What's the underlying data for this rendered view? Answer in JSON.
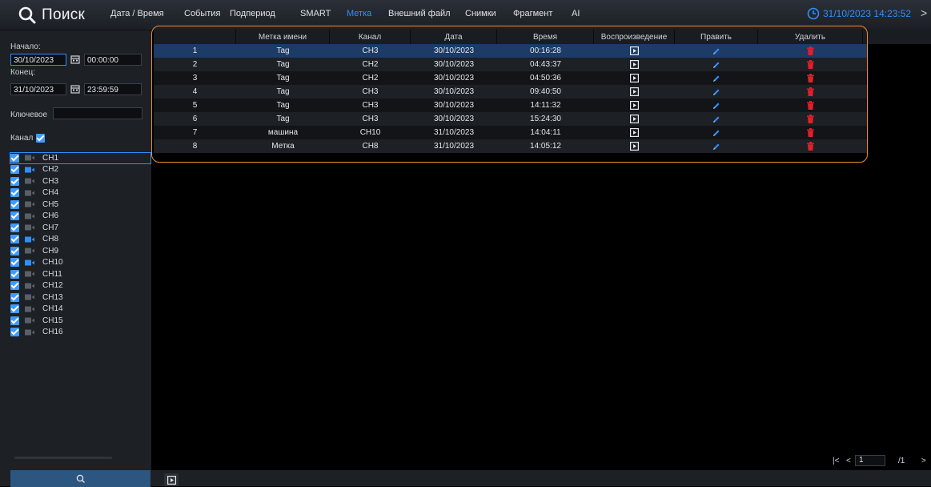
{
  "header": {
    "title": "Поиск",
    "tabs": [
      {
        "label": "Дата / Время",
        "active": false
      },
      {
        "label": "События",
        "active": false
      },
      {
        "label": "Подпериод",
        "active": false
      },
      {
        "label": "SMART",
        "active": false
      },
      {
        "label": "Метка",
        "active": true
      },
      {
        "label": "Внешний файл",
        "active": false
      },
      {
        "label": "Снимки",
        "active": false
      },
      {
        "label": "Фрагмент",
        "active": false
      },
      {
        "label": "AI",
        "active": false
      }
    ],
    "datetime": "31/10/2023 14:23:52",
    "close_glyph": ">"
  },
  "sidebar": {
    "start_label": "Начало:",
    "start_date": "30/10/2023",
    "start_time": "00:00:00",
    "end_label": "Конец:",
    "end_date": "31/10/2023",
    "end_time": "23:59:59",
    "keyword_label": "Ключевое",
    "keyword_value": "",
    "channel_label": "Канал",
    "channels": [
      {
        "name": "CH1",
        "checked": true,
        "active": false
      },
      {
        "name": "CH2",
        "checked": true,
        "active": true
      },
      {
        "name": "CH3",
        "checked": true,
        "active": false
      },
      {
        "name": "CH4",
        "checked": true,
        "active": false
      },
      {
        "name": "CH5",
        "checked": true,
        "active": false
      },
      {
        "name": "CH6",
        "checked": true,
        "active": false
      },
      {
        "name": "CH7",
        "checked": true,
        "active": false
      },
      {
        "name": "CH8",
        "checked": true,
        "active": true
      },
      {
        "name": "CH9",
        "checked": true,
        "active": false
      },
      {
        "name": "CH10",
        "checked": true,
        "active": true
      },
      {
        "name": "CH11",
        "checked": true,
        "active": false
      },
      {
        "name": "CH12",
        "checked": true,
        "active": false
      },
      {
        "name": "CH13",
        "checked": true,
        "active": false
      },
      {
        "name": "CH14",
        "checked": true,
        "active": false
      },
      {
        "name": "CH15",
        "checked": true,
        "active": false
      },
      {
        "name": "CH16",
        "checked": true,
        "active": false
      }
    ]
  },
  "table": {
    "columns": [
      "",
      "Метка имени",
      "Канал",
      "Дата",
      "Время",
      "Воспроизведение",
      "Править",
      "Удалить"
    ],
    "rows": [
      {
        "no": "1",
        "name": "Tag",
        "channel": "CH3",
        "date": "30/10/2023",
        "time": "00:16:28"
      },
      {
        "no": "2",
        "name": "Tag",
        "channel": "CH2",
        "date": "30/10/2023",
        "time": "04:43:37"
      },
      {
        "no": "3",
        "name": "Tag",
        "channel": "CH2",
        "date": "30/10/2023",
        "time": "04:50:36"
      },
      {
        "no": "4",
        "name": "Tag",
        "channel": "CH3",
        "date": "30/10/2023",
        "time": "09:40:50"
      },
      {
        "no": "5",
        "name": "Tag",
        "channel": "CH3",
        "date": "30/10/2023",
        "time": "14:11:32"
      },
      {
        "no": "6",
        "name": "Tag",
        "channel": "CH3",
        "date": "30/10/2023",
        "time": "15:24:30"
      },
      {
        "no": "7",
        "name": "машина",
        "channel": "CH10",
        "date": "31/10/2023",
        "time": "14:04:11"
      },
      {
        "no": "8",
        "name": "Метка",
        "channel": "CH8",
        "date": "31/10/2023",
        "time": "14:05:12"
      }
    ]
  },
  "pagination": {
    "first": "|<",
    "prev": "<",
    "page": "1",
    "total": "/1",
    "next": ">"
  },
  "icons": {
    "search": "search-icon",
    "clock": "clock-icon",
    "calendar": "calendar-icon",
    "camera": "camera-icon",
    "play": "play-icon",
    "edit": "pencil-icon",
    "delete": "trash-icon"
  },
  "colors": {
    "accent": "#2f8fff",
    "highlight": "#f08c33",
    "delete": "#e0202a",
    "checkbox": "#3f9bff",
    "selected_row": "#1c3b66"
  }
}
